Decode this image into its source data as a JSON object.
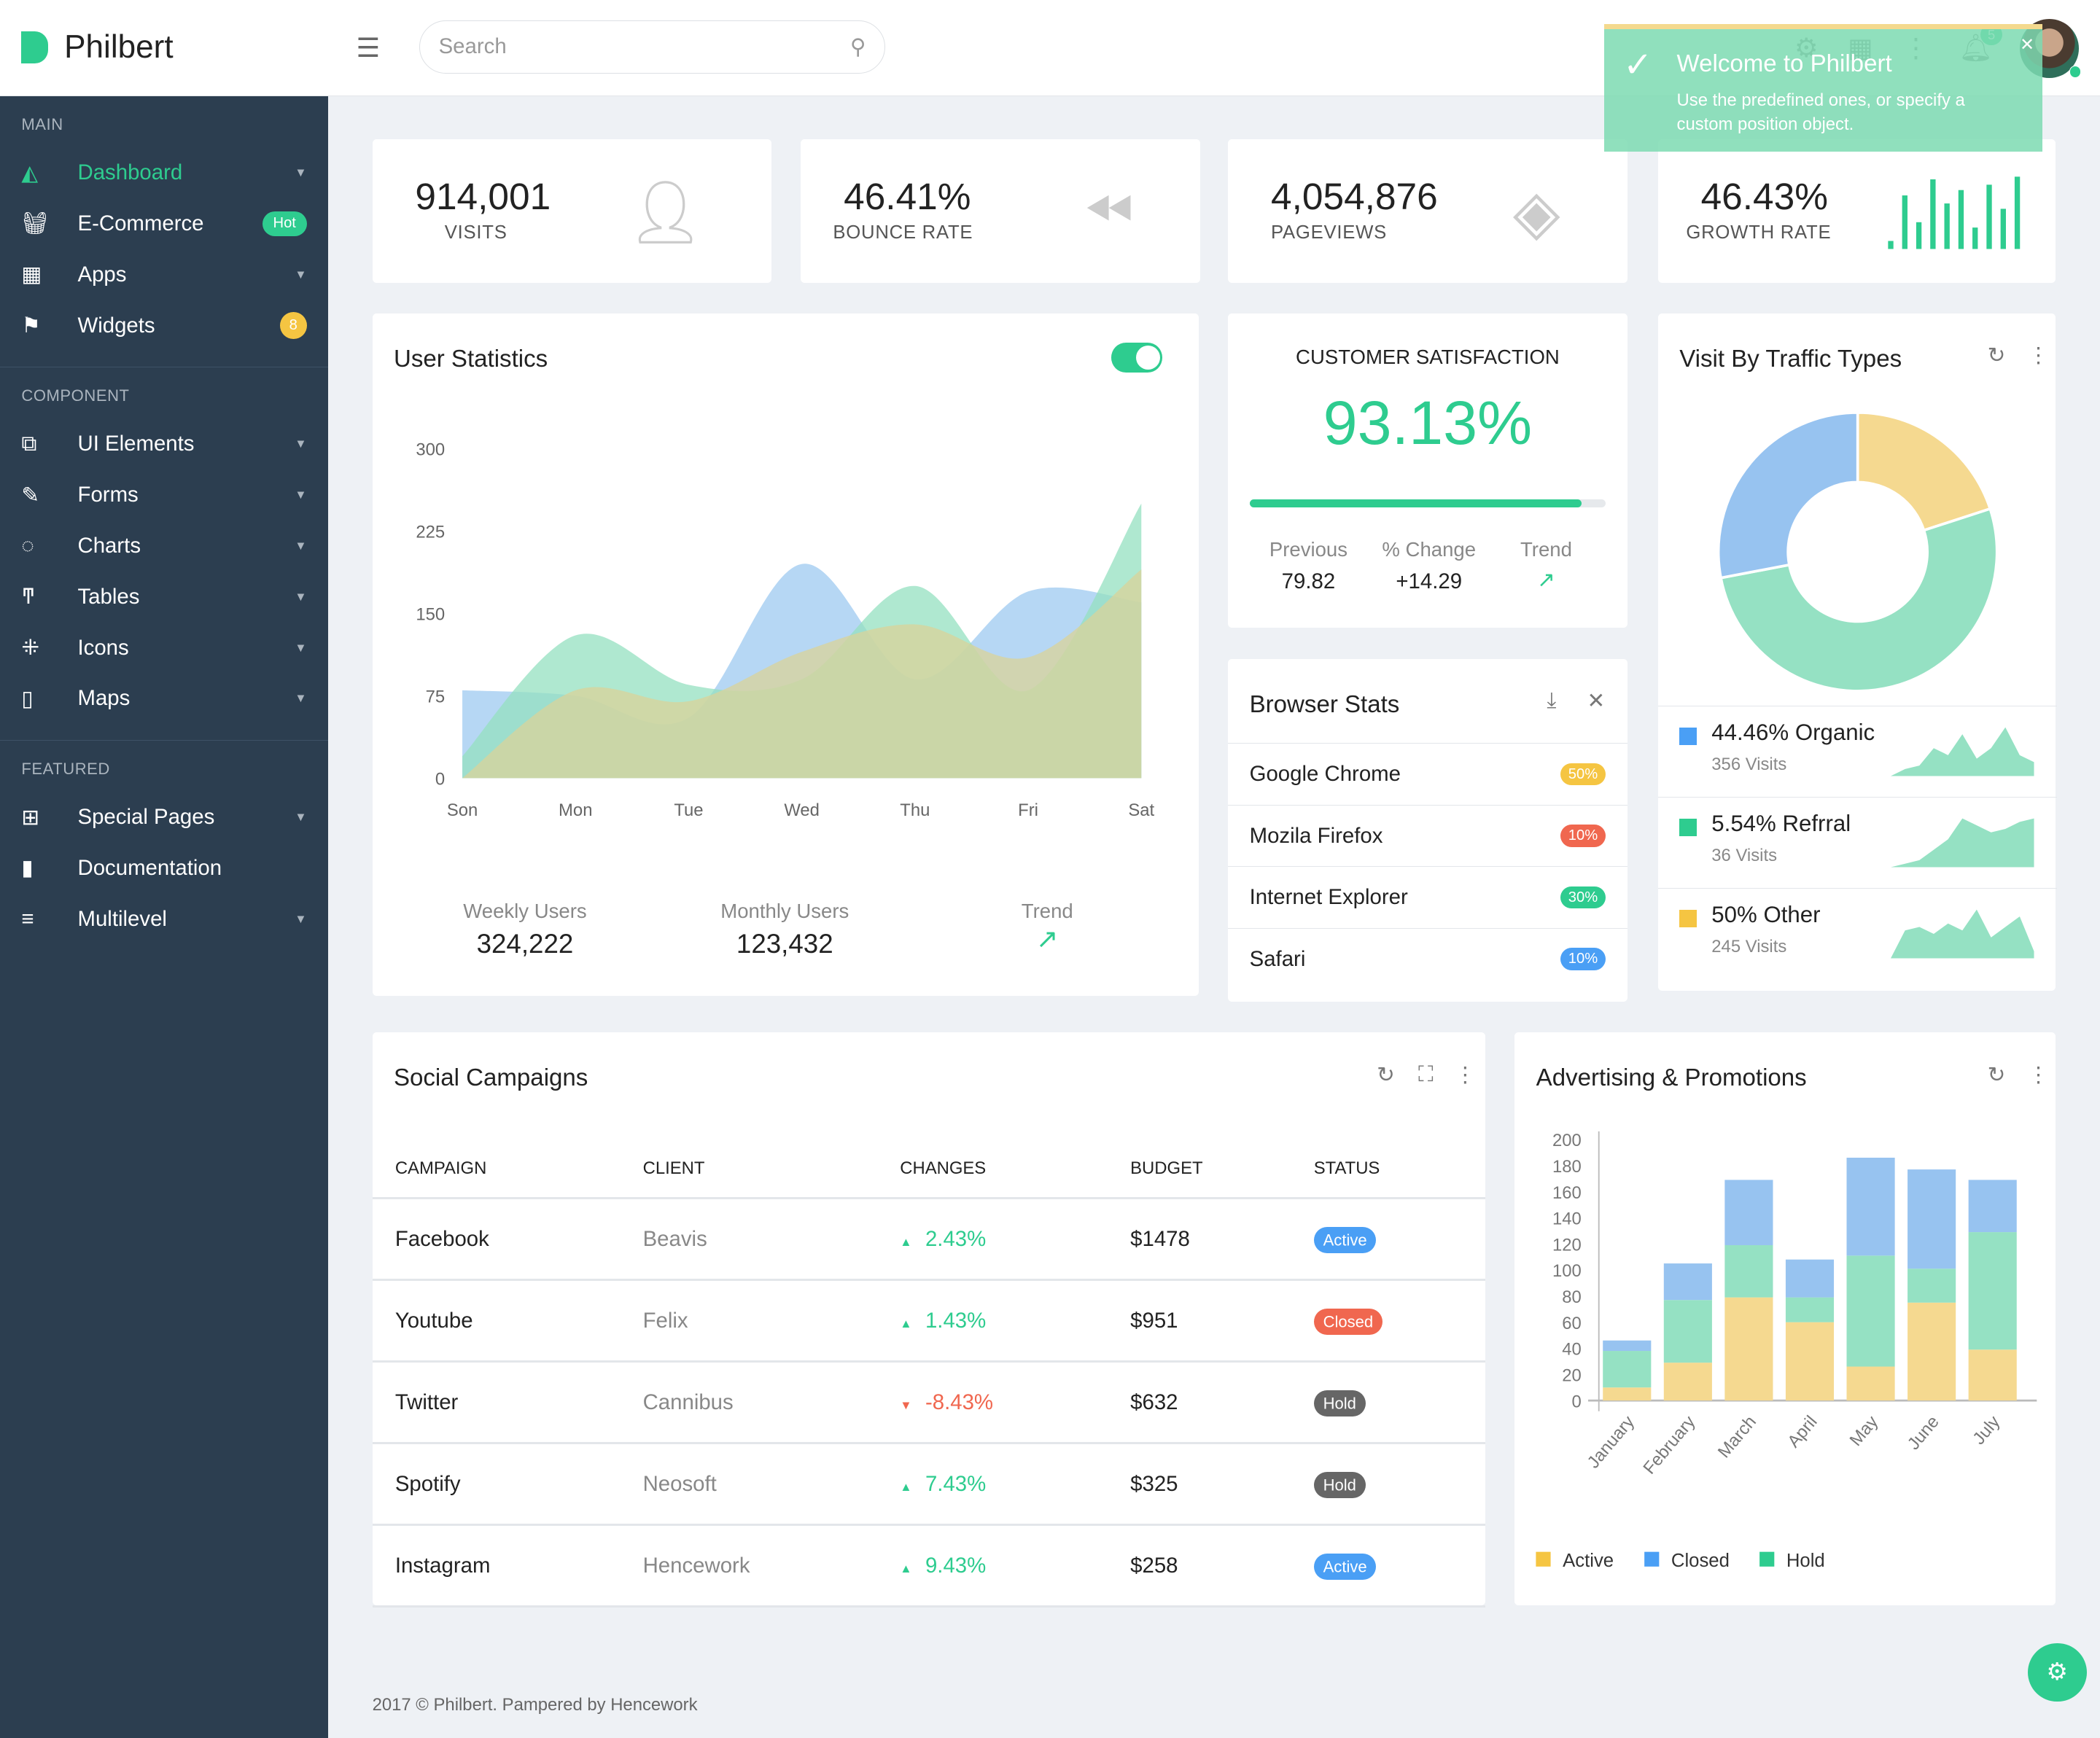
{
  "app": {
    "name": "Philbert"
  },
  "header": {
    "search_placeholder": "Search",
    "notification_count": "5"
  },
  "toast": {
    "title": "Welcome to Philbert",
    "message": "Use the predefined ones, or specify a custom position object."
  },
  "sidebar": {
    "sections": [
      {
        "title": "MAIN",
        "items": [
          {
            "label": "Dashboard",
            "icon": "chart-area-icon",
            "active": true
          },
          {
            "label": "E-Commerce",
            "icon": "basket-icon",
            "badge": "Hot"
          },
          {
            "label": "Apps",
            "icon": "grid-icon"
          },
          {
            "label": "Widgets",
            "icon": "flag-icon",
            "badge": "8"
          }
        ]
      },
      {
        "title": "COMPONENT",
        "items": [
          {
            "label": "UI Elements",
            "icon": "ui-icon"
          },
          {
            "label": "Forms",
            "icon": "pencil-icon"
          },
          {
            "label": "Charts",
            "icon": "pie-icon"
          },
          {
            "label": "Tables",
            "icon": "text-icon"
          },
          {
            "label": "Icons",
            "icon": "icons-icon"
          },
          {
            "label": "Maps",
            "icon": "map-icon"
          }
        ]
      },
      {
        "title": "FEATURED",
        "items": [
          {
            "label": "Special Pages",
            "icon": "pages-icon"
          },
          {
            "label": "Documentation",
            "icon": "book-icon"
          },
          {
            "label": "Multilevel",
            "icon": "filter-icon"
          }
        ]
      }
    ]
  },
  "stats": [
    {
      "value": "914,001",
      "label": "VISITS",
      "icon": "user-icon"
    },
    {
      "value": "46.41%",
      "label": "BOUNCE RATE",
      "icon": "rewind-icon"
    },
    {
      "value": "4,054,876",
      "label": "PAGEVIEWS",
      "icon": "layers-icon"
    },
    {
      "value": "46.43%",
      "label": "GROWTH RATE",
      "icon": "bars-icon"
    }
  ],
  "user_stats": {
    "title": "User Statistics",
    "weekly_label": "Weekly Users",
    "weekly_value": "324,222",
    "monthly_label": "Monthly Users",
    "monthly_value": "123,432",
    "trend_label": "Trend"
  },
  "satisfaction": {
    "title": "CUSTOMER SATISFACTION",
    "value": "93.13%",
    "progress": 93.13,
    "previous_label": "Previous",
    "previous": "79.82",
    "change_label": "% Change",
    "change": "+14.29",
    "trend_label": "Trend"
  },
  "browser_stats": {
    "title": "Browser Stats",
    "rows": [
      {
        "name": "Google Chrome",
        "pct": "50%",
        "color": "#f5c542"
      },
      {
        "name": "Mozila Firefox",
        "pct": "10%",
        "color": "#f0674f"
      },
      {
        "name": "Internet Explorer",
        "pct": "30%",
        "color": "#2ecc8f"
      },
      {
        "name": "Safari",
        "pct": "10%",
        "color": "#4a9ff5"
      }
    ]
  },
  "traffic": {
    "title": "Visit By Traffic Types",
    "legend": [
      {
        "label": "44.46% Organic",
        "visits": "356 Visits",
        "color": "#4a9ff5"
      },
      {
        "label": "5.54% Refrral",
        "visits": "36 Visits",
        "color": "#2ecc8f"
      },
      {
        "label": "50% Other",
        "visits": "245 Visits",
        "color": "#f5c542"
      }
    ]
  },
  "campaigns": {
    "title": "Social Campaigns",
    "columns": [
      "CAMPAIGN",
      "CLIENT",
      "CHANGES",
      "BUDGET",
      "STATUS"
    ],
    "rows": [
      {
        "campaign": "Facebook",
        "client": "Beavis",
        "change": "2.43%",
        "dir": "up",
        "budget": "$1478",
        "status": "Active"
      },
      {
        "campaign": "Youtube",
        "client": "Felix",
        "change": "1.43%",
        "dir": "up",
        "budget": "$951",
        "status": "Closed"
      },
      {
        "campaign": "Twitter",
        "client": "Cannibus",
        "change": "-8.43%",
        "dir": "down",
        "budget": "$632",
        "status": "Hold"
      },
      {
        "campaign": "Spotify",
        "client": "Neosoft",
        "change": "7.43%",
        "dir": "up",
        "budget": "$325",
        "status": "Hold"
      },
      {
        "campaign": "Instagram",
        "client": "Hencework",
        "change": "9.43%",
        "dir": "up",
        "budget": "$258",
        "status": "Active"
      }
    ]
  },
  "ads": {
    "title": "Advertising & Promotions"
  },
  "colors": {
    "accent": "#2ecc8f",
    "sidebar": "#2c3e50",
    "blue": "#4a9ff5",
    "yellow": "#f5c542",
    "red": "#f0674f",
    "gray": "#666"
  },
  "footer": "2017 © Philbert. Pampered by Hencework",
  "chart_data": [
    {
      "type": "area",
      "title": "User Statistics",
      "categories": [
        "Son",
        "Mon",
        "Tue",
        "Wed",
        "Thu",
        "Fri",
        "Sat"
      ],
      "ylim": [
        0,
        300
      ],
      "yticks": [
        0,
        75,
        150,
        225,
        300
      ],
      "series": [
        {
          "values": [
            80,
            75,
            55,
            195,
            90,
            170,
            160
          ],
          "color": "#9ec9f0"
        },
        {
          "values": [
            20,
            130,
            85,
            90,
            175,
            80,
            250
          ],
          "color": "#94e0c0"
        },
        {
          "values": [
            0,
            80,
            70,
            115,
            140,
            110,
            190
          ],
          "color": "#d9d39a"
        }
      ]
    },
    {
      "type": "pie",
      "title": "Visit By Traffic Types",
      "slices": [
        {
          "value": 20,
          "color": "#f5d990"
        },
        {
          "value": 52,
          "color": "#95e1c3"
        },
        {
          "value": 28,
          "color": "#97c3f0"
        }
      ]
    },
    {
      "type": "bar",
      "stacked": true,
      "title": "Advertising & Promotions",
      "categories": [
        "January",
        "February",
        "March",
        "April",
        "May",
        "June",
        "July"
      ],
      "ylim": [
        0,
        200
      ],
      "yticks": [
        0,
        20,
        40,
        60,
        80,
        100,
        120,
        140,
        160,
        180,
        200
      ],
      "legend": "bottom-left",
      "series": [
        {
          "name": "Active",
          "color": "#f5d990",
          "values": [
            10,
            29,
            79,
            60,
            26,
            75,
            39
          ]
        },
        {
          "name": "Hold",
          "color": "#95e1c3",
          "values": [
            28,
            48,
            40,
            19,
            85,
            26,
            90
          ]
        },
        {
          "name": "Closed",
          "color": "#97c3f0",
          "values": [
            8,
            28,
            50,
            29,
            75,
            76,
            40
          ]
        }
      ],
      "legend_order": [
        "Active",
        "Closed",
        "Hold"
      ]
    }
  ]
}
